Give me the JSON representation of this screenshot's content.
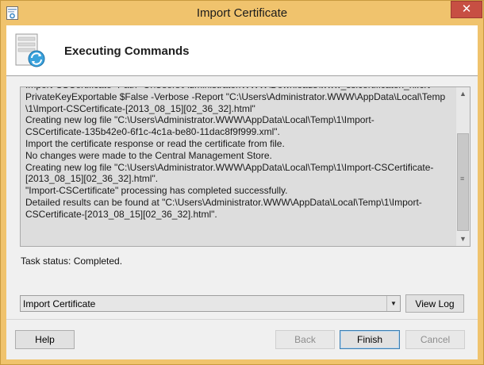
{
  "window": {
    "title": "Import Certificate",
    "close_label": "✕"
  },
  "header": {
    "title": "Executing Commands"
  },
  "log": {
    "text": "Import-CSCertificate -Path \"C:\\Users\\Administrator.WWW\\Downloads\\www_sslcertificaten_nl.crt\" -\nPrivateKeyExportable $False -Verbose -Report \"C:\\Users\\Administrator.WWW\\AppData\\Local\\Temp\n\\1\\Import-CSCertificate-[2013_08_15][02_36_32].html\"\nCreating new log file \"C:\\Users\\Administrator.WWW\\AppData\\Local\\Temp\\1\\Import-\nCSCertificate-135b42e0-6f1c-4c1a-be80-11dac8f9f999.xml\".\nImport the certificate response or read the certificate from file.\nNo changes were made to the Central Management Store.\nCreating new log file \"C:\\Users\\Administrator.WWW\\AppData\\Local\\Temp\\1\\Import-CSCertificate-\n[2013_08_15][02_36_32].html\".\n\"Import-CSCertificate\" processing has completed successfully.\nDetailed results can be found at \"C:\\Users\\Administrator.WWW\\AppData\\Local\\Temp\\1\\Import-\nCSCertificate-[2013_08_15][02_36_32].html\"."
  },
  "status": {
    "text": "Task status: Completed."
  },
  "log_selector": {
    "selected": "Import Certificate",
    "view_log_label": "View Log"
  },
  "footer": {
    "help_label": "Help",
    "back_label": "Back",
    "finish_label": "Finish",
    "cancel_label": "Cancel"
  },
  "colors": {
    "title_bar": "#f0c36d",
    "close_button": "#c74f43",
    "log_background": "#dddddd",
    "client_background": "#f0f0f0"
  },
  "icons": {
    "app": "certificate-app-icon",
    "header": "server-sync-icon",
    "close": "close-icon",
    "scroll_up": "chevron-up-icon",
    "scroll_down": "chevron-down-icon",
    "combo": "chevron-down-icon"
  }
}
